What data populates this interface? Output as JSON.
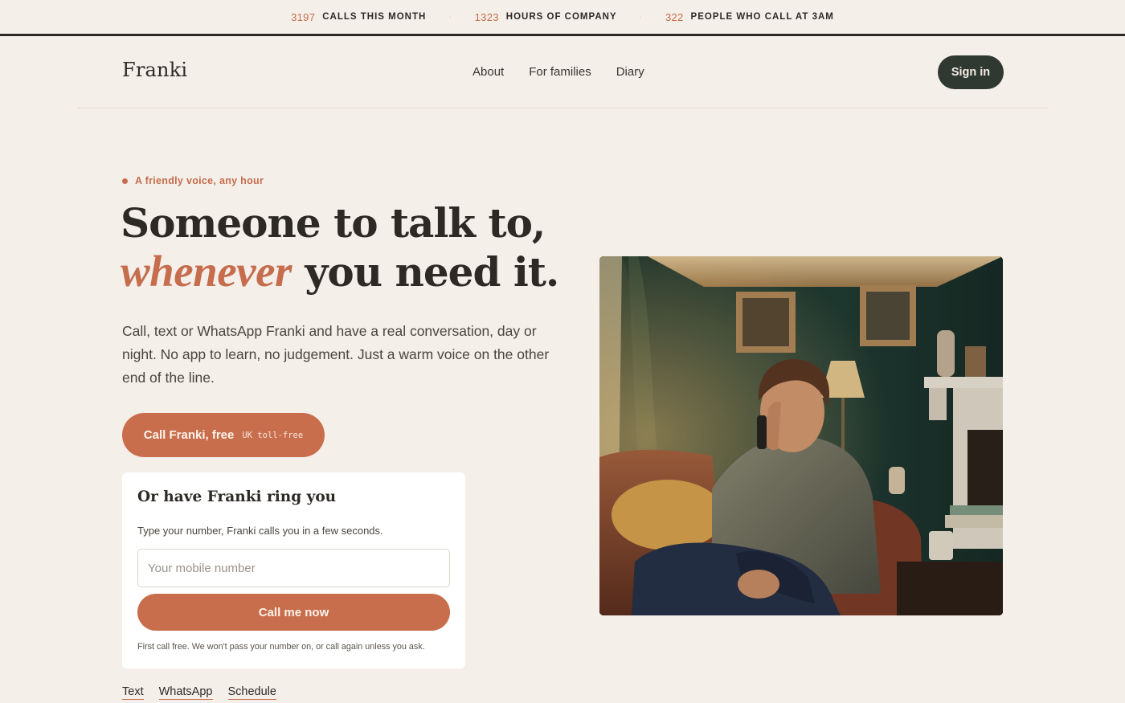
{
  "stats": [
    {
      "value": "3197",
      "label": "CALLS THIS MONTH"
    },
    {
      "value": "1323",
      "label": "HOURS OF COMPANY"
    },
    {
      "value": "322",
      "label": "PEOPLE WHO CALL AT 3AM"
    }
  ],
  "stats_separator": "·",
  "header": {
    "brand": "Franki",
    "nav": [
      "About",
      "For families",
      "Diary"
    ],
    "signin_label": "Sign in"
  },
  "hero": {
    "eyebrow": "A friendly voice, any hour",
    "headline_line1": "Someone to talk to,",
    "headline_accent": "whenever",
    "headline_rest": " you need it.",
    "lede": "Call, text or WhatsApp Franki and have a real conversation, day or night. No app to learn, no judgement. Just a warm voice on the other end of the line.",
    "cta_label": "Call Franki, free",
    "cta_note": "UK toll-free"
  },
  "ring_card": {
    "title": "Or have Franki ring you",
    "subtitle": "Type your number, Franki calls you in a few seconds.",
    "input_placeholder": "Your mobile number",
    "button_label": "Call me now",
    "footnote": "First call free. We won't pass your number on, or call again unless you ask."
  },
  "alt_links": [
    "Text",
    "WhatsApp",
    "Schedule"
  ],
  "colors": {
    "background": "#f5efe9",
    "accent": "#c96e4c",
    "dark_button": "#2f3932",
    "text": "#2d2a26"
  }
}
